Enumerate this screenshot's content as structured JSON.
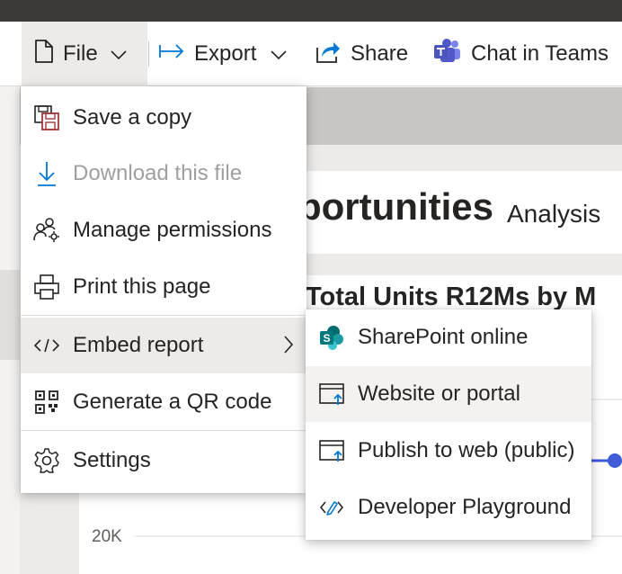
{
  "toolbar": {
    "file_label": "File",
    "export_label": "Export",
    "share_label": "Share",
    "teams_label": "Chat in Teams"
  },
  "report": {
    "title_partial": "portunities",
    "subtitle": "Analysis",
    "chart_title_partial": "Total Units R12Ms by M",
    "axis_tick": "20K"
  },
  "file_menu": {
    "items": [
      {
        "label": "Save a copy",
        "icon": "save-copy-icon"
      },
      {
        "label": "Download this file",
        "icon": "download-icon"
      },
      {
        "label": "Manage permissions",
        "icon": "permissions-icon"
      },
      {
        "label": "Print this page",
        "icon": "printer-icon"
      },
      {
        "label": "Embed report",
        "icon": "code-icon"
      },
      {
        "label": "Generate a QR code",
        "icon": "qr-code-icon"
      },
      {
        "label": "Settings",
        "icon": "gear-icon"
      }
    ]
  },
  "embed_menu": {
    "items": [
      {
        "label": "SharePoint online",
        "icon": "sharepoint-icon"
      },
      {
        "label": "Website or portal",
        "icon": "website-icon"
      },
      {
        "label": "Publish to web (public)",
        "icon": "publish-web-icon"
      },
      {
        "label": "Developer Playground",
        "icon": "developer-icon"
      }
    ]
  },
  "colors": {
    "accent": "#0078d4",
    "sharepoint": "#038387",
    "teams": "#5059c9",
    "save_icon": "#a4373a",
    "line_series": "#3f5bd8"
  }
}
